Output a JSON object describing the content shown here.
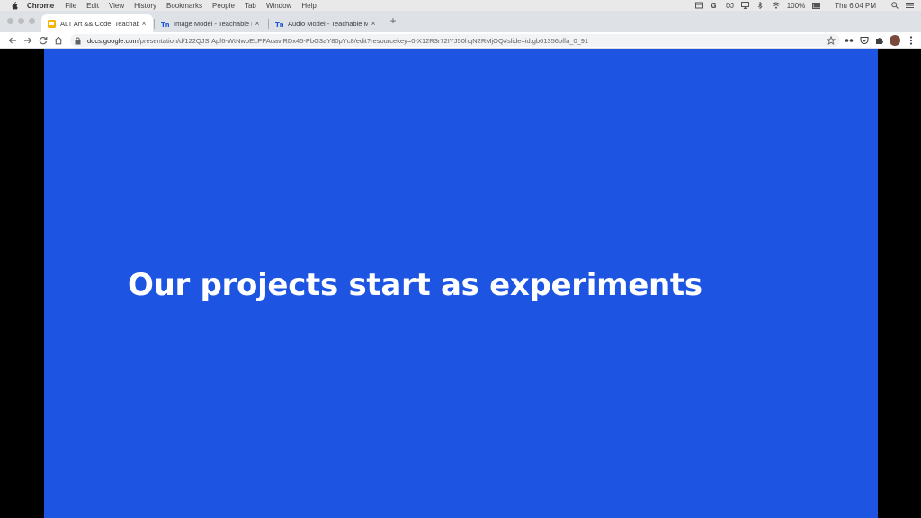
{
  "menubar": {
    "app_name": "Chrome",
    "menus": [
      "File",
      "Edit",
      "View",
      "History",
      "Bookmarks",
      "People",
      "Tab",
      "Window",
      "Help"
    ],
    "battery": "100%",
    "clock": "Thu 6:04 PM"
  },
  "tabs": [
    {
      "title": "ALT Art && Code: Teachable M",
      "favicon": "slides-icon",
      "active": true
    },
    {
      "title": "Image Model - Teachable Mach",
      "favicon": "teachable-machine-icon",
      "active": false
    },
    {
      "title": "Audio Model - Teachable Mach",
      "favicon": "teachable-machine-icon",
      "active": false
    }
  ],
  "new_tab_label": "+",
  "close_label": "×",
  "address_bar": {
    "host": "docs.google.com",
    "path": "/presentation/d/122QJSrApf6-WtNwoELPPAuaviRDx45-PbG3aY80pYc8/edit?resourcekey=0-X12R3r72IYJ50hqN2RMjOQ#slide=id.gb61356bffa_0_91"
  },
  "slide": {
    "title": "Our projects start as experiments",
    "background": "#1d54e2",
    "text_color": "#ffffff"
  }
}
